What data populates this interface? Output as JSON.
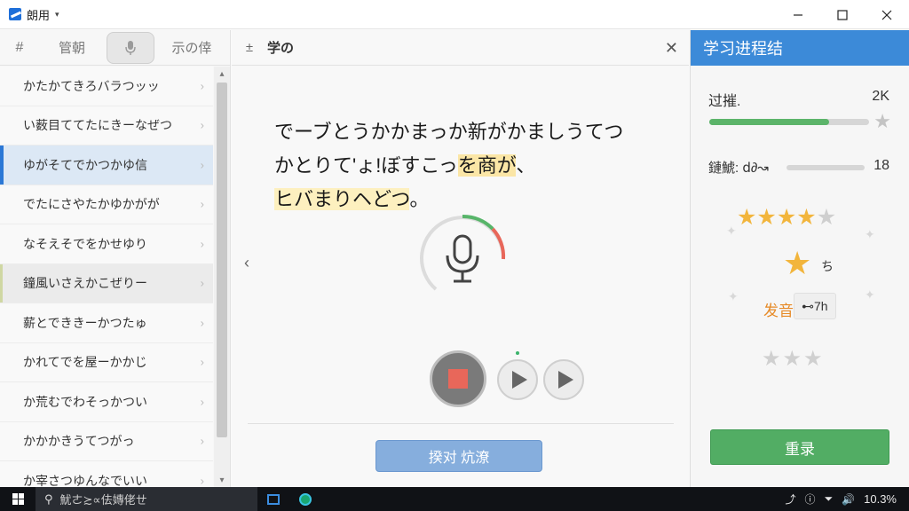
{
  "window": {
    "title": "朗用",
    "caret": "▾",
    "minimize": "—",
    "maximize": "☐",
    "close": "✕"
  },
  "left_panel": {
    "toolbar": {
      "hash": "#",
      "tab1": "管朝",
      "tab2": "示の倖"
    },
    "items": [
      {
        "label": "かたかてきろバラつッッ",
        "state": "normal"
      },
      {
        "label": "い薮目ててたにきーなぜつ",
        "state": "normal"
      },
      {
        "label": "ゆがそてでかつかゆ信",
        "state": "active"
      },
      {
        "label": "でたにさやたかゆかがが",
        "state": "normal"
      },
      {
        "label": "なそえそでをかせゆり",
        "state": "normal"
      },
      {
        "label": "鐘風いさえかこぜりー",
        "state": "hover"
      },
      {
        "label": "薪とでききーかつたゅ",
        "state": "normal"
      },
      {
        "label": "かれてでを屋ーかかじ",
        "state": "normal"
      },
      {
        "label": "か荒むでわそっかつい",
        "state": "normal"
      },
      {
        "label": "かかかきうてつがっ",
        "state": "normal"
      },
      {
        "label": "か宰さつゆんなでいい",
        "state": "normal"
      }
    ],
    "chevron": "›",
    "scroll_up": "▴",
    "scroll_down": "▾"
  },
  "center_panel": {
    "header_icon": "±",
    "title": "学の",
    "close": "✕",
    "passage": {
      "line1": "でーブとうかかまっか新がかましうてつ",
      "line2_a": "かとりて'ょ!ぼすこっ",
      "line2_hl": "を商が",
      "line2_b": "、",
      "line3_hl": "ヒバまりヘどつ",
      "line3_b": "。"
    },
    "nav_prev": "‹",
    "submit_label": "揆对  炕潦"
  },
  "right_panel": {
    "title": "学习进程结",
    "progress": {
      "label": "过摧.",
      "value": "2K",
      "fraction": 0.75
    },
    "fluency": {
      "label": "鏈鯱: ⅾ∂↝",
      "value": "18",
      "fraction": 0.0
    },
    "rating": {
      "filled": 4,
      "total": 5
    },
    "big_star_note": "ち",
    "pronunciation": {
      "label": "发音",
      "badge": "⊷7h"
    },
    "small_stars": 3,
    "rerecord_label": "重录"
  },
  "taskbar": {
    "search_text": "魷ㄜ≿∝佉嫥佬ㄝ",
    "tray_time": "10.3%",
    "tray_icons": [
      "⤴",
      "ⓘ",
      "⏷",
      "🔊"
    ]
  },
  "colors": {
    "accent_blue": "#3c8ad8",
    "green": "#52ad64",
    "orange": "#e68a27",
    "star": "#f2b53c",
    "record_red": "#e8675a"
  }
}
